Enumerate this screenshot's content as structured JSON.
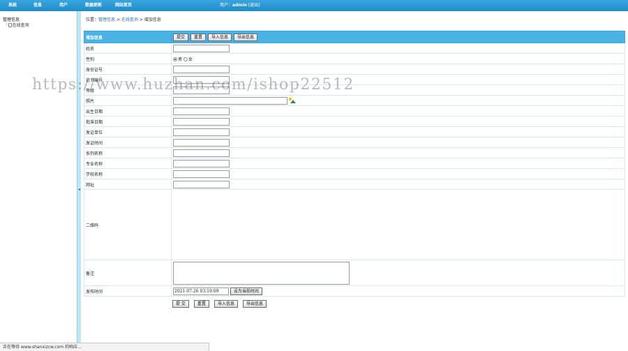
{
  "topnav": {
    "items": [
      "系统",
      "信息",
      "用户",
      "数据更新",
      "网站首页"
    ]
  },
  "user": {
    "prefix": "用户：",
    "name": "admin",
    "logout": "[退出]"
  },
  "sidebar": {
    "root_label": "管理信息",
    "child_prefix": "└",
    "child_label": "在线查询"
  },
  "breadcrumb": {
    "prefix": "位置：",
    "level1": "管理信息",
    "sep": " > ",
    "level2": "在线查询",
    "level3": "增加信息"
  },
  "form": {
    "header_label": "增加信息",
    "header_buttons": [
      "提交",
      "重置",
      "导入信息",
      "导出信息"
    ],
    "fields": {
      "name": "姓名",
      "gender": "性别",
      "gender_options": [
        "男",
        "女"
      ],
      "gender_selected": "男",
      "idcard": "身份证号",
      "cert_no": "证书编号",
      "level": "等级",
      "photo": "照片",
      "birth": "出生日期",
      "approve_date": "批准日期",
      "issuer": "发证单位",
      "issue_time": "发证时间",
      "series": "系列名称",
      "major": "专业名称",
      "school": "学校名称",
      "website": "网址",
      "qrcode": "二维码",
      "remark": "备注",
      "pubtime": "发布时间",
      "pubtime_value": "2021-07-26 03:19:09",
      "set_now": "设为当前时间"
    },
    "bottom_buttons": [
      "提 交",
      "重置",
      "导入信息",
      "导出信息"
    ]
  },
  "watermark": "https://www.huzhan.com/ishop22512",
  "statusbar": "正在等待 www.shanxizcw.com 的响应..."
}
